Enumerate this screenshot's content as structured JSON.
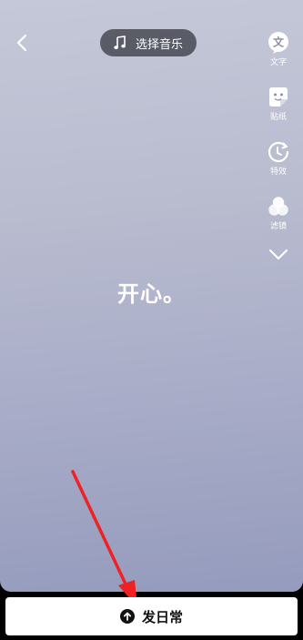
{
  "topbar": {
    "music_label": "选择音乐"
  },
  "tools": [
    {
      "label": "文字",
      "icon": "text-icon"
    },
    {
      "label": "贴纸",
      "icon": "sticker-icon"
    },
    {
      "label": "特效",
      "icon": "effects-icon"
    },
    {
      "label": "滤镜",
      "icon": "filter-icon"
    }
  ],
  "content": {
    "text": "开心。"
  },
  "bottom": {
    "post_label": "发日常"
  },
  "colors": {
    "annotation_arrow": "#ee2222",
    "pill_bg": "#3c3e46"
  }
}
